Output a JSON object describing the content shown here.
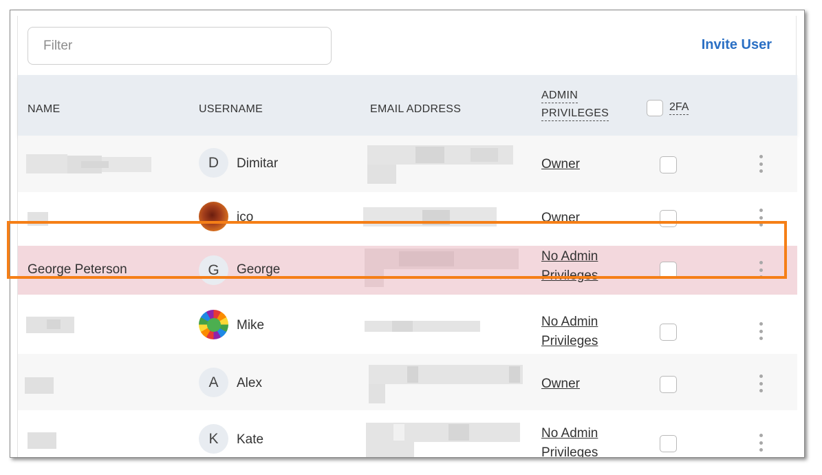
{
  "filter": {
    "placeholder": "Filter",
    "value": ""
  },
  "invite_label": "Invite User",
  "columns": {
    "name": "NAME",
    "username": "USERNAME",
    "email": "EMAIL ADDRESS",
    "admin_line1": "ADMIN",
    "admin_line2": "PRIVILEGES",
    "twofa": "2FA"
  },
  "rows": [
    {
      "name": "",
      "avatar_letter": "D",
      "avatar_type": "letter",
      "username": "Dimitar",
      "admin_line1": "Owner",
      "admin_line2": "",
      "twofa_checked": false
    },
    {
      "name": "",
      "avatar_letter": "",
      "avatar_type": "image-eclipse",
      "username": "ico",
      "admin_line1": "Owner",
      "admin_line2": "",
      "twofa_checked": false
    },
    {
      "name": "George Peterson",
      "avatar_letter": "G",
      "avatar_type": "letter",
      "username": "George",
      "admin_line1": "No Admin",
      "admin_line2": "Privileges",
      "twofa_checked": false,
      "highlighted": true
    },
    {
      "name": "",
      "avatar_letter": "",
      "avatar_type": "image-wheel",
      "username": "Mike",
      "admin_line1": "No Admin",
      "admin_line2": "Privileges",
      "twofa_checked": false
    },
    {
      "name": "",
      "avatar_letter": "A",
      "avatar_type": "letter",
      "username": "Alex",
      "admin_line1": "Owner",
      "admin_line2": "",
      "twofa_checked": false
    },
    {
      "name": "",
      "avatar_letter": "K",
      "avatar_type": "letter",
      "username": "Kate",
      "admin_line1": "No Admin",
      "admin_line2": "Privileges",
      "twofa_checked": false
    }
  ],
  "colors": {
    "accent": "#2a6fc4",
    "highlight_border": "#f57f17",
    "highlight_row": "#f3d8dd",
    "header_bg": "#e9edf2"
  }
}
